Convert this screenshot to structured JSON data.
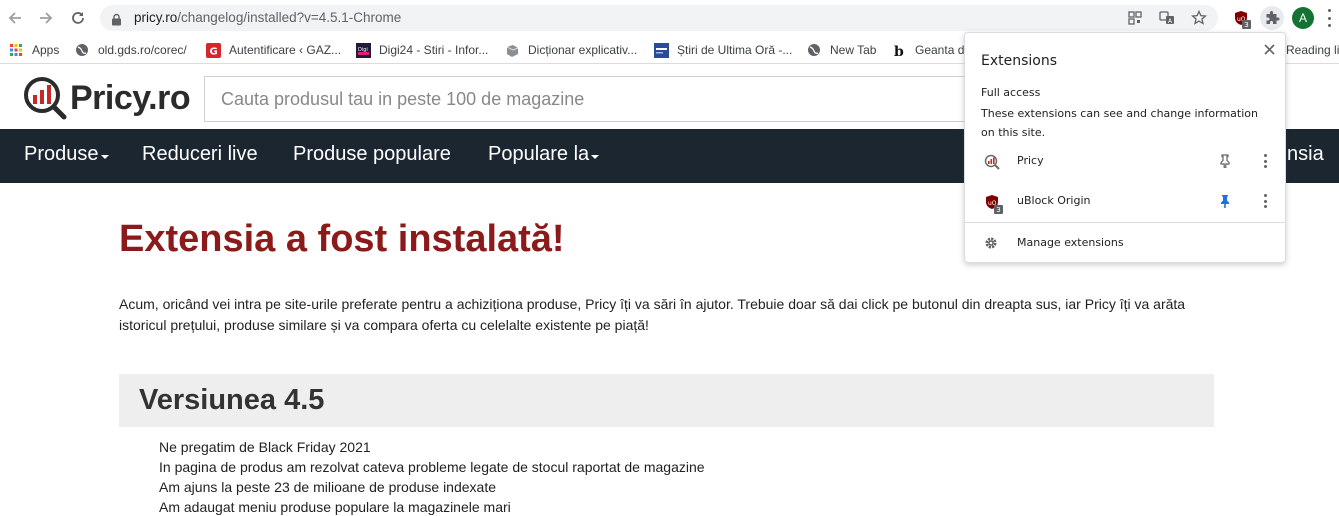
{
  "browser": {
    "url_host": "pricy.ro",
    "url_path": "/changelog/installed?v=4.5.1-Chrome",
    "profile_initial": "A",
    "ublock_badge": "3"
  },
  "bookmarks": [
    {
      "label": "Apps",
      "icon": "apps-grid-icon"
    },
    {
      "label": "old.gds.ro/corec/",
      "icon": "globe-icon"
    },
    {
      "label": "Autentificare ‹ GAZ...",
      "icon": "gazeta-favicon"
    },
    {
      "label": "Digi24 - Stiri - Infor...",
      "icon": "digi24-favicon"
    },
    {
      "label": "Dicționar explicativ...",
      "icon": "dictionary-favicon"
    },
    {
      "label": "Știri de Ultima Oră -...",
      "icon": "news-favicon"
    },
    {
      "label": "New Tab",
      "icon": "globe-icon"
    },
    {
      "label": "Geanta de",
      "icon": "b-favicon"
    },
    {
      "label": "Reading lis",
      "icon": "reading-list-icon"
    }
  ],
  "site": {
    "logo_text": "Pricy.ro",
    "search_placeholder": "Cauta produsul tau in peste 100 de magazine",
    "nav": [
      {
        "label": "Produse",
        "dropdown": true
      },
      {
        "label": "Reduceri live",
        "dropdown": false
      },
      {
        "label": "Produse populare",
        "dropdown": false
      },
      {
        "label": "Populare la",
        "dropdown": true
      },
      {
        "label": "nsia",
        "dropdown": false
      }
    ]
  },
  "content": {
    "title": "Extensia a fost instalată!",
    "intro": "Acum, oricând vei intra pe site-urile preferate pentru a achiziționa produse, Pricy îți va sări în ajutor. Trebuie doar să dai click pe butonul din dreapta sus, iar Pricy îți va arăta istoricul prețului, produse similare și va compara oferta cu celelalte existente pe piață!",
    "version_title": "Versiunea 4.5",
    "changes": [
      "Ne pregatim de Black Friday 2021",
      "In pagina de produs am rezolvat cateva probleme legate de stocul raportat de magazine",
      "Am ajuns la peste 23 de milioane de produse indexate",
      "Am adaugat meniu produse populare la magazinele mari"
    ]
  },
  "extensions_popup": {
    "title": "Extensions",
    "section_title": "Full access",
    "section_desc": "These extensions can see and change information on this site.",
    "items": [
      {
        "name": "Pricy",
        "icon": "pricy-logo-icon",
        "pinned": false
      },
      {
        "name": "uBlock Origin",
        "icon": "ublock-origin-icon",
        "pinned": true
      }
    ],
    "manage_label": "Manage extensions"
  },
  "colors": {
    "title_red": "#8b1a1a",
    "nav_bg": "#1b2631",
    "pin_active": "#1a73e8",
    "version_bg": "#eeeeee"
  }
}
